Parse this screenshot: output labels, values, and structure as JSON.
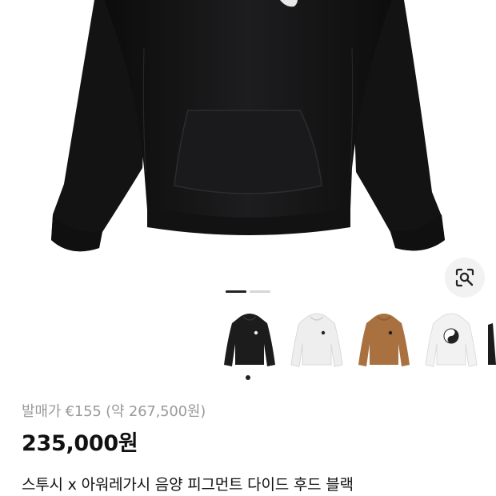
{
  "product": {
    "original_price_text": "발매가 €155 (약 267,500원)",
    "price_text": "235,000원",
    "title": "스투시 x 아워레가시 음양 피그먼트 다이드 후드 블랙"
  },
  "gallery": {
    "pager_total": 2,
    "pager_active": 1,
    "lens_icon": "lens-search-icon"
  },
  "thumbnails": [
    {
      "color": "#1c1c1c",
      "name": "black-hoodie",
      "selected": true
    },
    {
      "color": "#eeeeee",
      "name": "white-hoodie",
      "selected": false
    },
    {
      "color": "#a9713f",
      "name": "brown-hoodie",
      "selected": false
    },
    {
      "color": "#f2f2f2",
      "name": "white-yinyang-hoodie",
      "selected": false
    },
    {
      "color": "#1c1c1c",
      "name": "black-hoodie-partial",
      "selected": false
    }
  ]
}
